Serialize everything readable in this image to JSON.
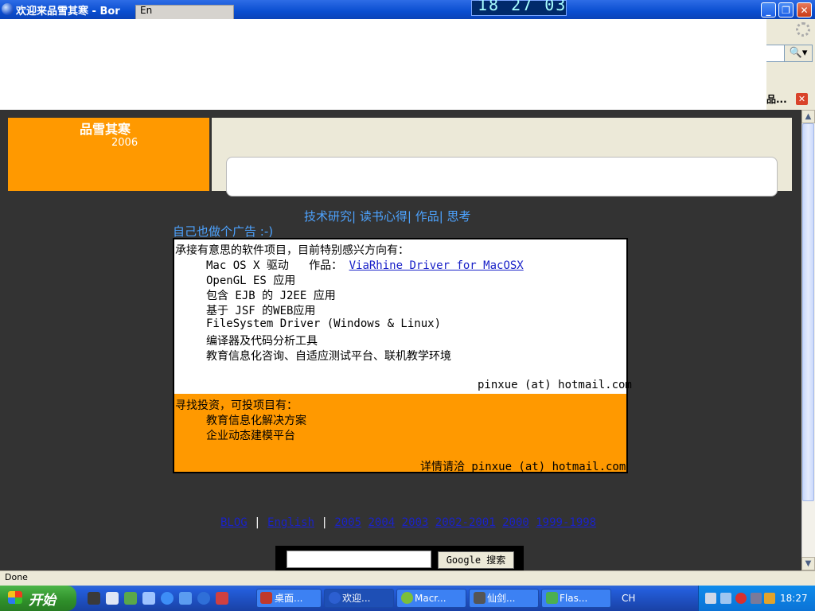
{
  "window": {
    "title": "欢迎来品雪其寒 - Bor",
    "lang_indicator": "En",
    "clock": "18 27 03"
  },
  "browser": {
    "tab_label": "品...",
    "status": "Done"
  },
  "site": {
    "name": "品雪其寒",
    "year": "2006",
    "nav": [
      "技术研究",
      "读书心得",
      "作品",
      "思考"
    ],
    "ad_heading": "自己也做个广告 :-)",
    "offer": {
      "intro": "承接有意思的软件项目，目前特别感兴方向有：",
      "line1_prefix": "Mac OS X 驱动   作品：",
      "line1_link": "ViaRhine Driver for MacOSX",
      "items": [
        "OpenGL ES 应用",
        "包含 EJB 的 J2EE 应用",
        "基于 JSF 的WEB应用",
        "FileSystem Driver (Windows & Linux)",
        "编译器及代码分析工具",
        "教育信息化咨询、自适应测试平台、联机教学环境"
      ],
      "contact": "pinxue (at) hotmail.com"
    },
    "invest": {
      "intro": "寻找投资，可投项目有：",
      "items": [
        "教育信息化解决方案",
        "企业动态建模平台"
      ],
      "contact": "详情请洽 pinxue (at) hotmail.com"
    },
    "footer_links": [
      "BLOG",
      "English",
      "2005",
      "2004",
      "2003",
      "2002-2001",
      "2000",
      "1999-1998"
    ],
    "google_button": "Google 搜索"
  },
  "taskbar": {
    "start_label": "开始",
    "tasks": [
      "桌面...",
      "欢迎...",
      "Macr...",
      "仙剑...",
      "Flas..."
    ],
    "ime": "CH",
    "time": "18:27"
  },
  "colors": {
    "page_bg": "#333333",
    "orange": "#ff9900",
    "link": "#1a22c8",
    "nav_link": "#4da3ff"
  }
}
